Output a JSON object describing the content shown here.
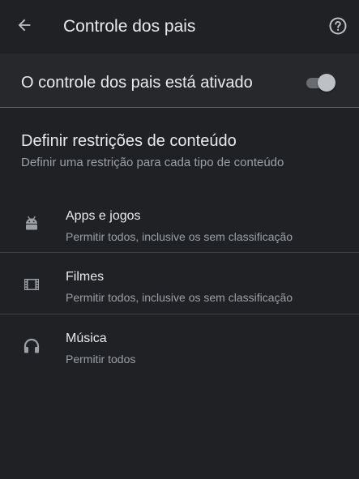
{
  "header": {
    "title": "Controle dos pais",
    "back_icon": "arrow-back-icon",
    "help_icon": "help-circle-icon"
  },
  "master_switch": {
    "label": "O controle dos pais está ativado",
    "enabled": true
  },
  "section": {
    "title": "Definir restrições de conteúdo",
    "subtitle": "Definir uma restrição para cada tipo de conteúdo"
  },
  "items": [
    {
      "title": "Apps e jogos",
      "subtitle": "Permitir todos, inclusive os sem classificação",
      "icon": "android-icon"
    },
    {
      "title": "Filmes",
      "subtitle": "Permitir todos, inclusive os sem classificação",
      "icon": "film-icon"
    },
    {
      "title": "Música",
      "subtitle": "Permitir todos",
      "icon": "headphones-icon"
    }
  ],
  "colors": {
    "background": "#202124",
    "highlight_row": "#27282c",
    "primary_text": "#e8eaed",
    "secondary_text": "#9aa0a6",
    "divider": "#3c4043"
  }
}
